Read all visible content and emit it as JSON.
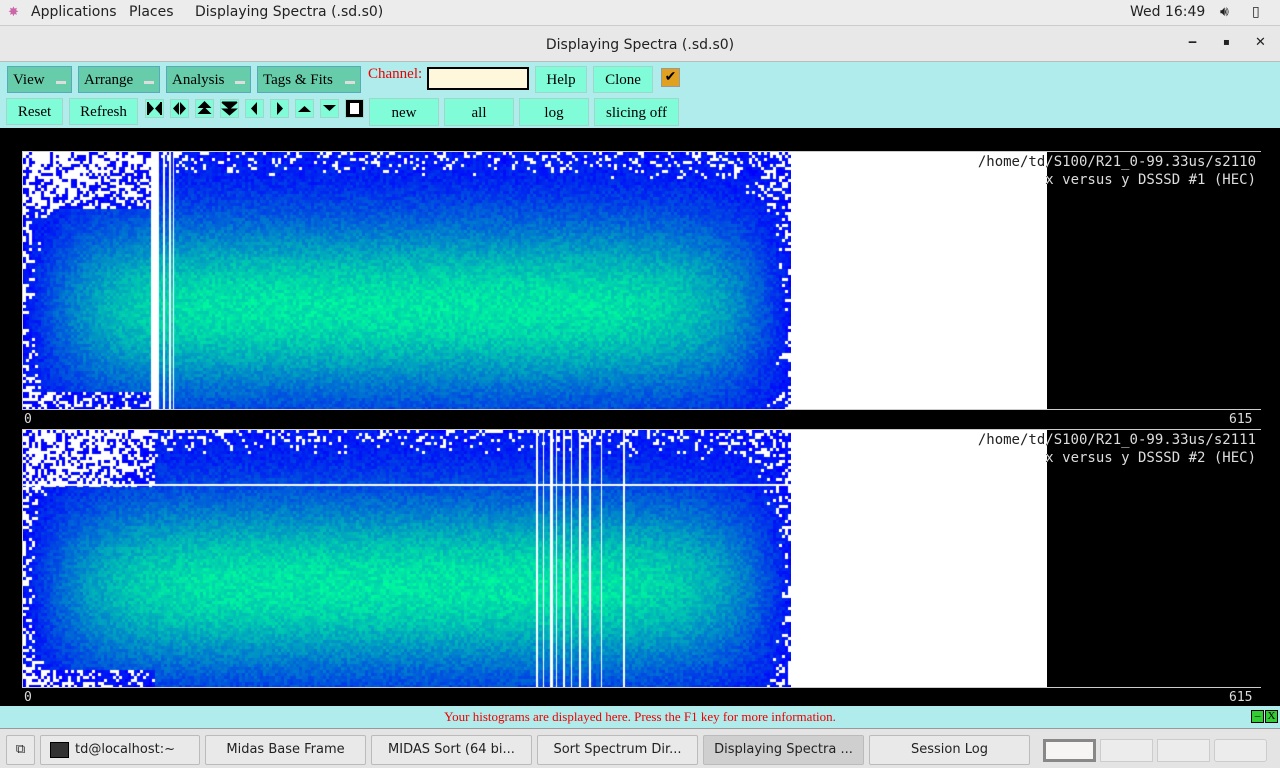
{
  "topbar": {
    "applications": "Applications",
    "places": "Places",
    "active_app": "Displaying Spectra (.sd.s0)",
    "clock": "Wed 16:49"
  },
  "window": {
    "title": "Displaying Spectra (.sd.s0)",
    "minimize": "‒",
    "maximize": "▪",
    "close": "✕"
  },
  "toolbar": {
    "menus": [
      "View",
      "Arrange",
      "Analysis",
      "Tags & Fits"
    ],
    "channel_label": "Channel:",
    "channel_value": "",
    "help": "Help",
    "clone": "Clone",
    "checkbox_checked": true,
    "checkmark": "✔",
    "reset": "Reset",
    "refresh": "Refresh",
    "nav_icons": [
      "expand-horizontal",
      "compress-horizontal",
      "expand-vertical",
      "compress-vertical",
      "left",
      "right",
      "up",
      "down",
      "stop"
    ],
    "new": "new",
    "all": "all",
    "log": "log",
    "slicing": "slicing off"
  },
  "plots": [
    {
      "path": "/home/td/S100/R21_0-99.33us/s2110",
      "title": "x versus y DSSSD #1 (HEC)",
      "x_min": "0",
      "x_max": "615"
    },
    {
      "path": "/home/td/S100/R21_0-99.33us/s2111",
      "title": "x versus y DSSSD #2 (HEC)",
      "x_min": "0",
      "x_max": "615"
    }
  ],
  "status": {
    "message": "Your histograms are displayed here. Press the F1 key for more information.",
    "min": "–",
    "close": "X"
  },
  "taskbar": {
    "tasks": [
      "td@localhost:~",
      "Midas Base Frame",
      "MIDAS Sort (64 bi...",
      "Sort Spectrum Dir...",
      "Displaying Spectra ...",
      "Session Log"
    ],
    "active_index": 4
  },
  "colors": {
    "toolbar_bg": "#b0ecec",
    "button": "#80fcd8",
    "menu": "#66ccaa",
    "status_text": "#e00000",
    "heat_low": "#0000ff",
    "heat_high": "#00ff99"
  }
}
